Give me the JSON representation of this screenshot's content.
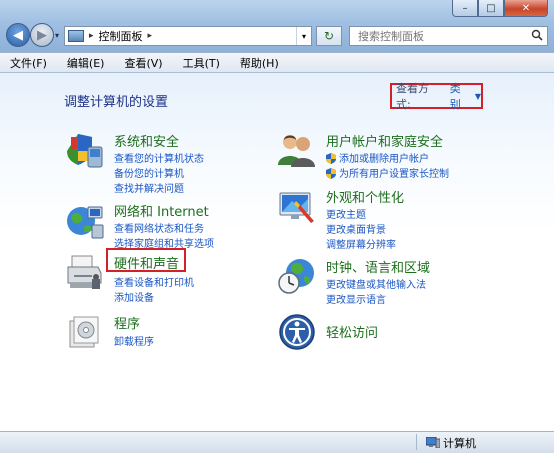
{
  "window": {
    "controls": [
      "–",
      "□",
      "✕"
    ]
  },
  "nav": {
    "back_glyph": "◀",
    "forward_glyph": "▶",
    "dropdown_glyph": "▾",
    "refresh_glyph": "↻"
  },
  "address": {
    "sep1": "▸",
    "path": "控制面板",
    "sep2": "▸",
    "dropdown_glyph": "▾"
  },
  "search": {
    "placeholder": "搜索控制面板"
  },
  "menu": [
    "文件(F)",
    "编辑(E)",
    "查看(V)",
    "工具(T)",
    "帮助(H)"
  ],
  "content": {
    "heading": "调整计算机的设置",
    "view_by": {
      "label": "查看方式:",
      "value": "类别",
      "caret": "▼"
    }
  },
  "categories": {
    "system": {
      "title": "系统和安全",
      "links": [
        "查看您的计算机状态",
        "备份您的计算机",
        "查找并解决问题"
      ]
    },
    "network": {
      "title": "网络和 Internet",
      "links": [
        "查看网络状态和任务",
        "选择家庭组和共享选项"
      ]
    },
    "hardware": {
      "title": "硬件和声音",
      "links": [
        "查看设备和打印机",
        "添加设备"
      ]
    },
    "programs": {
      "title": "程序",
      "links": [
        "卸载程序"
      ]
    },
    "users": {
      "title": "用户帐户和家庭安全",
      "links": [
        "添加或删除用户帐户",
        "为所有用户设置家长控制"
      ]
    },
    "appearance": {
      "title": "外观和个性化",
      "links": [
        "更改主题",
        "更改桌面背景",
        "调整屏幕分辨率"
      ]
    },
    "clock": {
      "title": "时钟、语言和区域",
      "links": [
        "更改键盘或其他输入法",
        "更改显示语言"
      ]
    },
    "ease": {
      "title": "轻松访问",
      "links": []
    }
  },
  "status": {
    "computer": "计算机"
  },
  "colors": {
    "highlight": "#d4202a",
    "link": "#1a56c4",
    "category_title": "#1c6e1c",
    "heading": "#1e3287"
  }
}
